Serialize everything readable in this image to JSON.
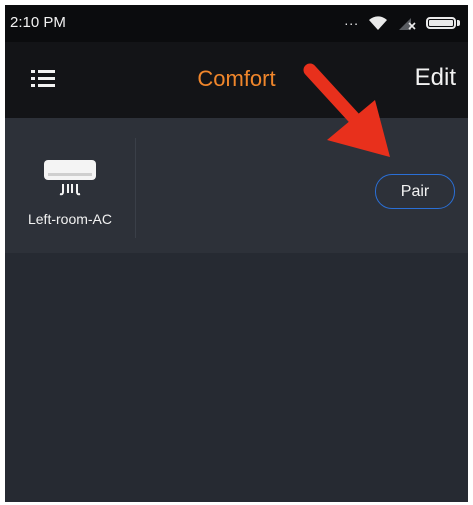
{
  "status_bar": {
    "time": "2:10 PM",
    "dots": "...",
    "icons": [
      "signal-icon",
      "wifi-icon",
      "no-sim-icon",
      "battery-icon"
    ]
  },
  "app_bar": {
    "title": "Comfort",
    "edit_label": "Edit",
    "menu_icon": "list-menu-icon"
  },
  "devices": [
    {
      "name": "Left-room-AC",
      "icon": "air-conditioner-icon"
    }
  ],
  "pair_button": {
    "label": "Pair"
  },
  "colors": {
    "accent": "#f0862b",
    "pair_border": "#2a6fd6",
    "annotation_arrow": "#e8301c",
    "background": "#262a32",
    "panel": "#2d3139",
    "app_bar": "#131417",
    "status_bar": "#0b0c0e"
  }
}
